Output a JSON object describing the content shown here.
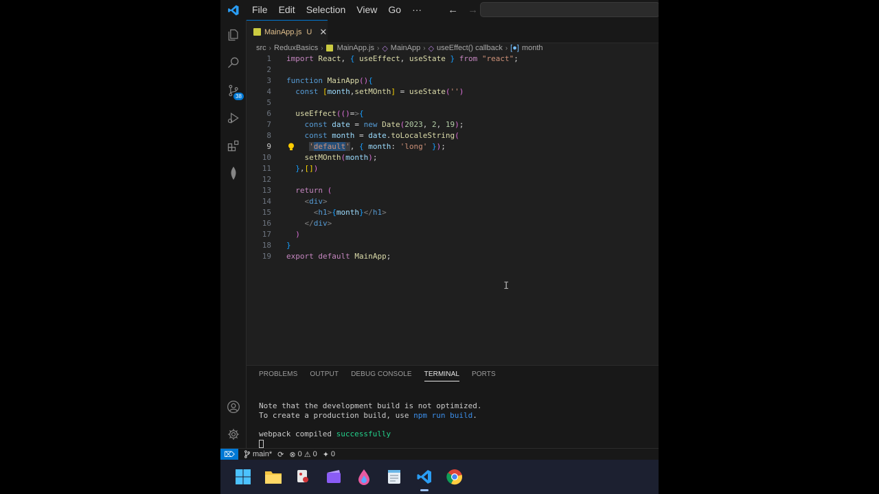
{
  "menu": [
    "File",
    "Edit",
    "Selection",
    "View",
    "Go",
    "···"
  ],
  "tab": {
    "name": "MainApp.js",
    "status": "U"
  },
  "breadcrumb": [
    "src",
    "ReduxBasics",
    "MainApp.js",
    "MainApp",
    "useEffect() callback",
    "month"
  ],
  "activity_badge": "38",
  "panel_tabs": [
    "PROBLEMS",
    "OUTPUT",
    "DEBUG CONSOLE",
    "TERMINAL",
    "PORTS"
  ],
  "active_panel_tab": "TERMINAL",
  "terminal": {
    "line1": "Note that the development build is not optimized.",
    "line2_prefix": "To create a production build, use ",
    "line2_cmd": "npm run build",
    "line2_suffix": ".",
    "line3_prefix": "webpack compiled ",
    "line3_status": "successfully"
  },
  "status": {
    "branch": "main*",
    "errors": "0",
    "warnings": "0",
    "ports": "0"
  },
  "code_lines": [
    {
      "n": "1",
      "t": "import React, { useEffect, useState } from \"react\";"
    },
    {
      "n": "2",
      "t": ""
    },
    {
      "n": "3",
      "t": "function MainApp(){"
    },
    {
      "n": "4",
      "t": "  const [month,setMOnth] = useState('')"
    },
    {
      "n": "5",
      "t": ""
    },
    {
      "n": "6",
      "t": "  useEffect(()=>{"
    },
    {
      "n": "7",
      "t": "    const date = new Date(2023, 2, 19);"
    },
    {
      "n": "8",
      "t": "    const month = date.toLocaleString("
    },
    {
      "n": "9",
      "t": "     'default', { month: 'long' });"
    },
    {
      "n": "10",
      "t": "    setMOnth(month);"
    },
    {
      "n": "11",
      "t": "  },[])"
    },
    {
      "n": "12",
      "t": ""
    },
    {
      "n": "13",
      "t": "  return ("
    },
    {
      "n": "14",
      "t": "    <div>"
    },
    {
      "n": "15",
      "t": "      <h1>{month}</h1>"
    },
    {
      "n": "16",
      "t": "    </div>"
    },
    {
      "n": "17",
      "t": "  )"
    },
    {
      "n": "18",
      "t": "}"
    },
    {
      "n": "19",
      "t": "export default MainApp;"
    }
  ],
  "colors": {
    "accent": "#0078d4",
    "editor_bg": "#1f1f1f",
    "keyword": "#c586c0",
    "function": "#dcdcaa",
    "variable": "#9cdcfe",
    "string": "#ce9178"
  }
}
